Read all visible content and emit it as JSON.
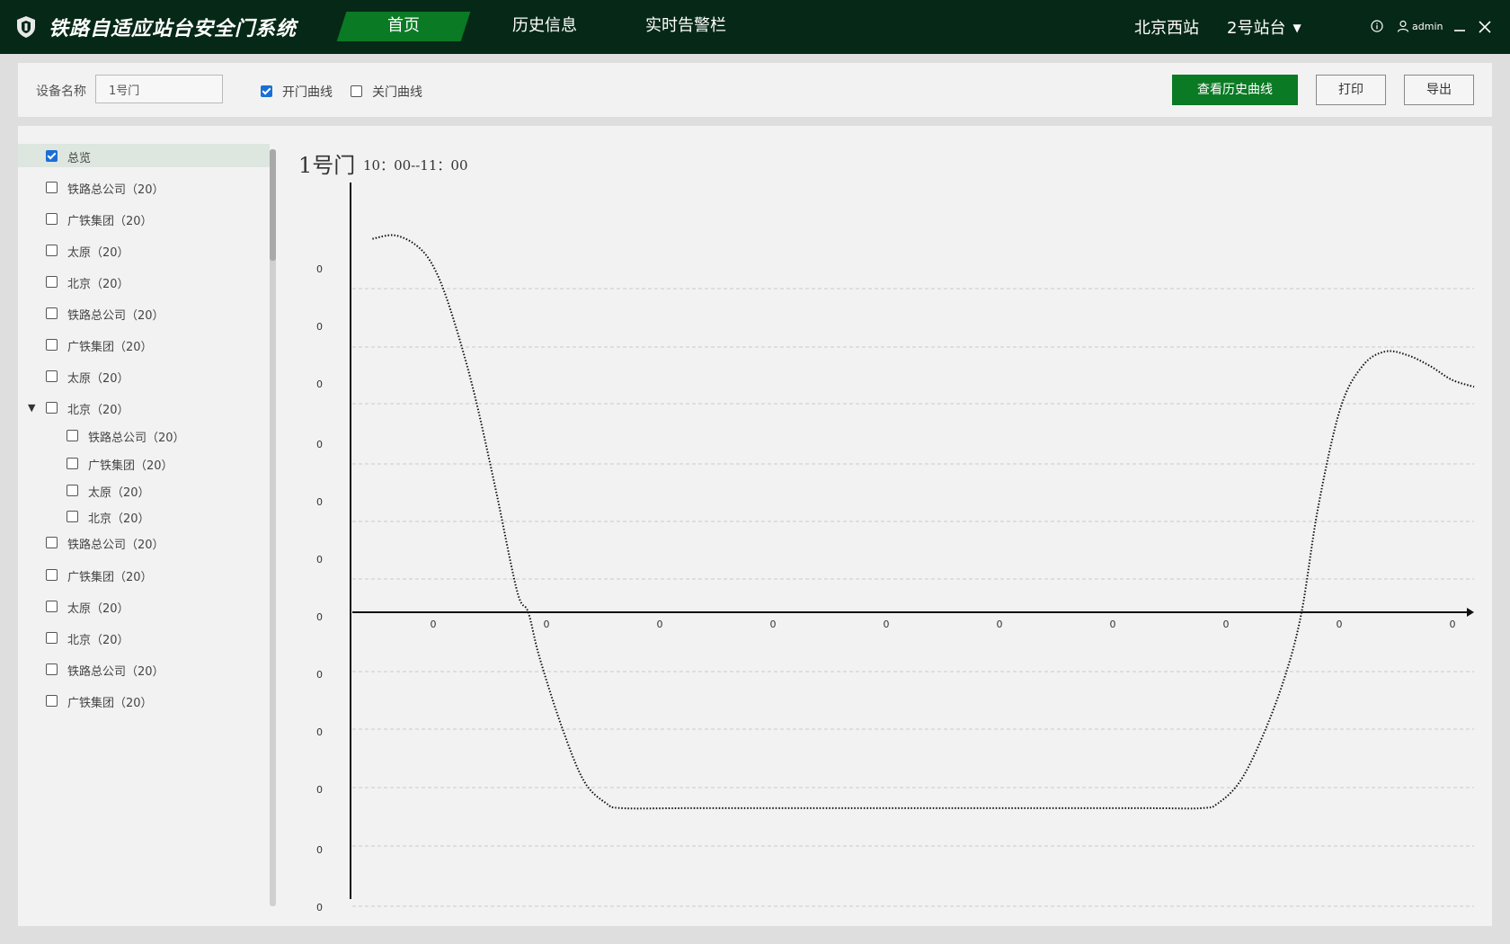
{
  "header": {
    "app_title": "铁路自适应站台安全门系统",
    "nav_tabs": [
      {
        "label": "首页",
        "active": true
      },
      {
        "label": "历史信息",
        "active": false
      },
      {
        "label": "实时告警栏",
        "active": false
      }
    ],
    "station": "北京西站",
    "platform": "2号站台",
    "username": "admin",
    "icons": [
      "shield-logo-icon",
      "info-icon",
      "user-icon",
      "minimize-icon",
      "close-icon"
    ],
    "colors": {
      "bar_bg": "#062817",
      "accent": "#0a7a24"
    }
  },
  "toolbar": {
    "device_label": "设备名称",
    "device_value": "1号门",
    "open_curve_label": "开门曲线",
    "open_curve_checked": true,
    "close_curve_label": "关门曲线",
    "close_curve_checked": false,
    "view_history_label": "查看历史曲线",
    "print_label": "打印",
    "export_label": "导出"
  },
  "tree": {
    "items": [
      {
        "label": "总览",
        "checked": true,
        "selected": true,
        "level": 0
      },
      {
        "label": "铁路总公司（20）",
        "checked": false,
        "level": 0
      },
      {
        "label": "广铁集团（20）",
        "checked": false,
        "level": 0
      },
      {
        "label": "太原（20）",
        "checked": false,
        "level": 0
      },
      {
        "label": "北京（20）",
        "checked": false,
        "level": 0
      },
      {
        "label": "铁路总公司（20）",
        "checked": false,
        "level": 0
      },
      {
        "label": "广铁集团（20）",
        "checked": false,
        "level": 0
      },
      {
        "label": "太原（20）",
        "checked": false,
        "level": 0
      },
      {
        "label": "北京（20）",
        "checked": false,
        "level": 0,
        "expanded": true
      },
      {
        "label": "铁路总公司（20）",
        "checked": false,
        "level": 1
      },
      {
        "label": "广铁集团（20）",
        "checked": false,
        "level": 1
      },
      {
        "label": "太原（20）",
        "checked": false,
        "level": 1
      },
      {
        "label": "北京（20）",
        "checked": false,
        "level": 1
      },
      {
        "label": "铁路总公司（20）",
        "checked": false,
        "level": 0
      },
      {
        "label": "广铁集团（20）",
        "checked": false,
        "level": 0
      },
      {
        "label": "太原（20）",
        "checked": false,
        "level": 0
      },
      {
        "label": "北京（20）",
        "checked": false,
        "level": 0
      },
      {
        "label": "铁路总公司（20）",
        "checked": false,
        "level": 0
      },
      {
        "label": "广铁集团（20）",
        "checked": false,
        "level": 0
      }
    ]
  },
  "chart": {
    "title": "1号门",
    "time_range": "10：00--11：00"
  },
  "chart_data": {
    "type": "line",
    "title": "1号门",
    "subtitle": "10：00--11：00",
    "xlabel": "",
    "ylabel": "",
    "x_tick_labels": [
      "0",
      "0",
      "0",
      "0",
      "0",
      "0",
      "0",
      "0",
      "0",
      "0"
    ],
    "y_tick_labels": [
      "0",
      "0",
      "0",
      "0",
      "0",
      "0",
      "0",
      "0",
      "0",
      "0",
      "0",
      "0"
    ],
    "xlim": [
      0,
      100
    ],
    "ylim": [
      -6,
      5.5
    ],
    "grid": true,
    "series": [
      {
        "style": "dotted",
        "color": "#111111",
        "points": [
          [
            1,
            5.3
          ],
          [
            3,
            5.35
          ],
          [
            5,
            5.2
          ],
          [
            6.5,
            4.9
          ],
          [
            8,
            4.3
          ],
          [
            10,
            3.2
          ],
          [
            12,
            1.8
          ],
          [
            14,
            0.3
          ],
          [
            15,
            0
          ],
          [
            16,
            -0.9
          ],
          [
            18,
            -2.3
          ],
          [
            20,
            -3.4
          ],
          [
            22,
            -3.85
          ],
          [
            23.5,
            -3.95
          ],
          [
            30,
            -3.95
          ],
          [
            50,
            -3.95
          ],
          [
            70,
            -3.95
          ],
          [
            75.5,
            -3.95
          ],
          [
            77,
            -3.85
          ],
          [
            79,
            -3.4
          ],
          [
            81,
            -2.5
          ],
          [
            83,
            -1.3
          ],
          [
            84.5,
            0
          ],
          [
            86,
            1.5
          ],
          [
            88,
            2.9
          ],
          [
            90,
            3.5
          ],
          [
            92,
            3.7
          ],
          [
            94,
            3.65
          ],
          [
            96,
            3.5
          ],
          [
            98,
            3.3
          ],
          [
            100,
            3.2
          ]
        ]
      }
    ]
  }
}
